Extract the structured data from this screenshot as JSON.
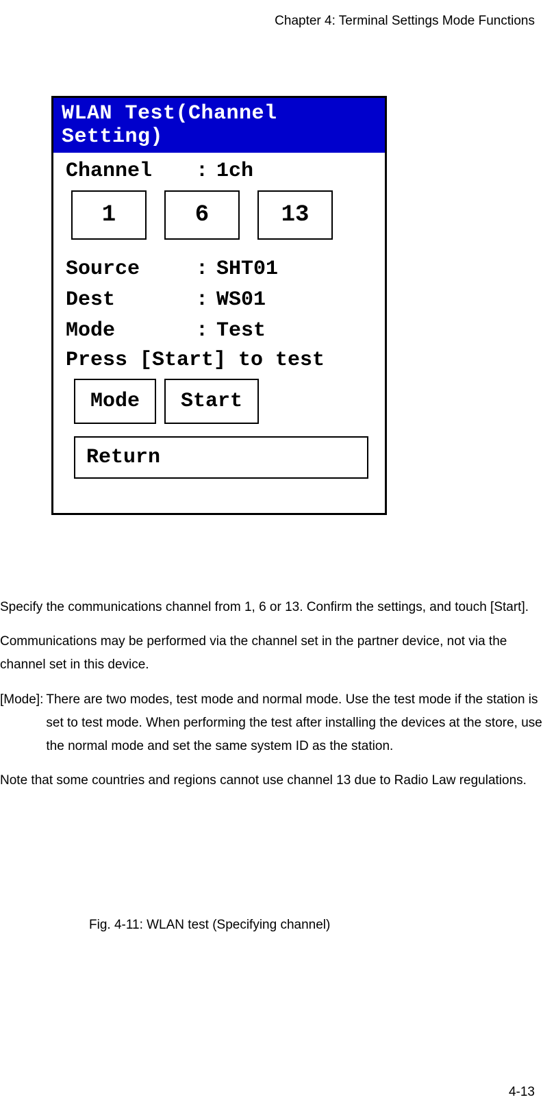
{
  "header": "Chapter 4: Terminal Settings Mode Functions",
  "screen": {
    "title": "WLAN Test(Channel Setting)",
    "channel_label": "Channel",
    "channel_value": "1ch",
    "channel_options": [
      "1",
      "6",
      "13"
    ],
    "source_label": "Source",
    "source_value": "SHT01",
    "dest_label": "Dest",
    "dest_value": "WS01",
    "mode_label": "Mode",
    "mode_value": "Test",
    "press_line": "Press [Start] to test",
    "mode_button": "Mode",
    "start_button": "Start",
    "return_button": "Return"
  },
  "body": {
    "p1": "Specify the communications channel from 1, 6 or 13. Confirm the settings, and touch [Start].",
    "p2": "Communications may be performed via the channel set in the partner device, not via the channel set in this device.",
    "p3_label": "[Mode]:",
    "p3_text": "There are two modes, test mode and normal mode. Use the test mode if the station is set to test mode. When performing the test after installing the devices at the store, use the normal mode and set the same system ID as the station.",
    "p4": "Note that some countries and regions cannot use channel 13 due to Radio Law regulations."
  },
  "figure_caption": "Fig. 4-11: WLAN test (Specifying channel)",
  "page_number": "4-13"
}
